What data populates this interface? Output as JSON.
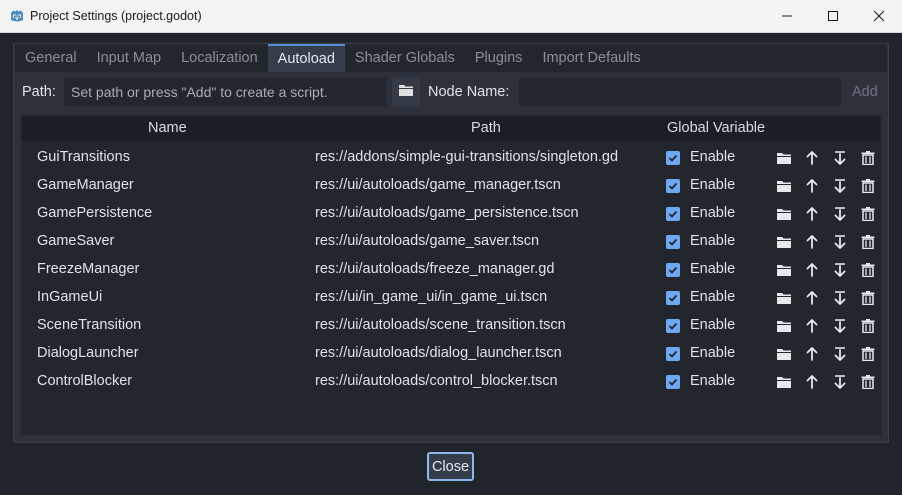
{
  "window": {
    "title": "Project Settings (project.godot)",
    "controls": [
      "minimize-icon",
      "maximize-icon",
      "close-icon"
    ]
  },
  "tabs": [
    {
      "label": "General",
      "active": false
    },
    {
      "label": "Input Map",
      "active": false
    },
    {
      "label": "Localization",
      "active": false
    },
    {
      "label": "Autoload",
      "active": true
    },
    {
      "label": "Shader Globals",
      "active": false
    },
    {
      "label": "Plugins",
      "active": false
    },
    {
      "label": "Import Defaults",
      "active": false
    }
  ],
  "path_row": {
    "path_label": "Path:",
    "path_placeholder": "Set path or press \"Add\" to create a script.",
    "folder_icon": "folder-icon",
    "node_name_label": "Node Name:",
    "node_name_value": "",
    "add_label": "Add"
  },
  "table": {
    "headers": {
      "name": "Name",
      "path": "Path",
      "global": "Global Variable"
    },
    "rows": [
      {
        "name": "GuiTransitions",
        "path": "res://addons/simple-gui-transitions/singleton.gd",
        "enabled": true,
        "enable_label": "Enable"
      },
      {
        "name": "GameManager",
        "path": "res://ui/autoloads/game_manager.tscn",
        "enabled": true,
        "enable_label": "Enable"
      },
      {
        "name": "GamePersistence",
        "path": "res://ui/autoloads/game_persistence.tscn",
        "enabled": true,
        "enable_label": "Enable"
      },
      {
        "name": "GameSaver",
        "path": "res://ui/autoloads/game_saver.tscn",
        "enabled": true,
        "enable_label": "Enable"
      },
      {
        "name": "FreezeManager",
        "path": "res://ui/autoloads/freeze_manager.gd",
        "enabled": true,
        "enable_label": "Enable"
      },
      {
        "name": "InGameUi",
        "path": "res://ui/in_game_ui/in_game_ui.tscn",
        "enabled": true,
        "enable_label": "Enable"
      },
      {
        "name": "SceneTransition",
        "path": "res://ui/autoloads/scene_transition.tscn",
        "enabled": true,
        "enable_label": "Enable"
      },
      {
        "name": "DialogLauncher",
        "path": "res://ui/autoloads/dialog_launcher.tscn",
        "enabled": true,
        "enable_label": "Enable"
      },
      {
        "name": "ControlBlocker",
        "path": "res://ui/autoloads/control_blocker.tscn",
        "enabled": true,
        "enable_label": "Enable"
      }
    ],
    "row_actions": [
      "folder-icon",
      "move-up-icon",
      "move-down-icon",
      "trash-icon"
    ]
  },
  "footer": {
    "close_label": "Close"
  },
  "colors": {
    "accent": "#5a8ed8",
    "checkbox": "#6fa8f0",
    "background": "#20242b"
  }
}
